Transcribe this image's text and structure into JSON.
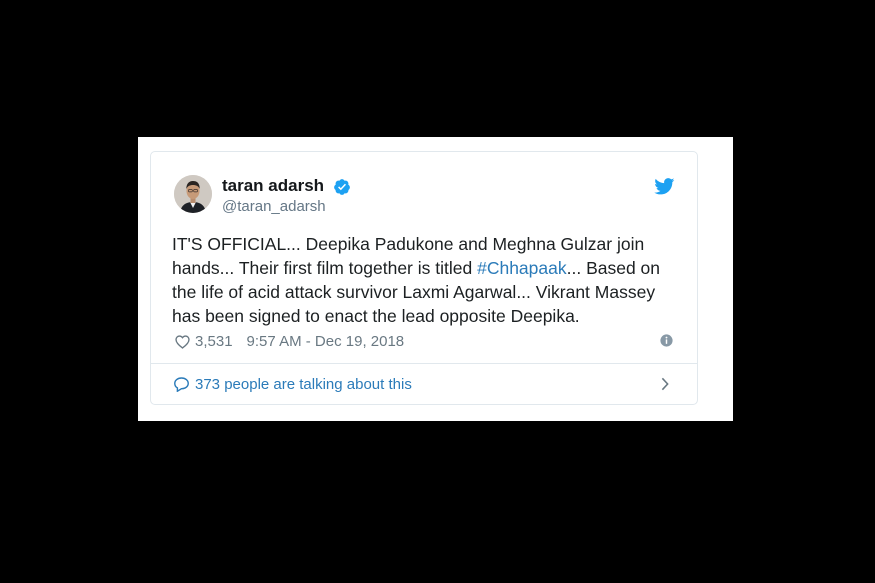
{
  "tweet": {
    "author": {
      "display_name": "taran adarsh",
      "handle": "@taran_adarsh",
      "verified": true
    },
    "text_before_hashtag": "IT'S OFFICIAL... Deepika Padukone and Meghna Gulzar join hands... Their first film together is titled ",
    "hashtag": "#Chhapaak",
    "text_after_hashtag": "... Based on the life of acid attack survivor Laxmi Agarwal... Vikrant Massey has been signed to enact the lead opposite Deepika.",
    "like_count": "3,531",
    "timestamp": "9:57 AM - Dec 19, 2018",
    "talking_text": "373 people are talking about this"
  },
  "icons": {
    "verified": "verified-badge-icon",
    "brand": "twitter-bird-icon",
    "like": "heart-icon",
    "info": "info-icon",
    "reply": "speech-bubble-icon",
    "more": "chevron-right-icon"
  },
  "colors": {
    "background": "#000000",
    "card": "#ffffff",
    "border": "#e1e8ed",
    "text": "#1c2022",
    "muted": "#697882",
    "link": "#2b7bb9",
    "twitter_blue": "#1da1f2"
  }
}
